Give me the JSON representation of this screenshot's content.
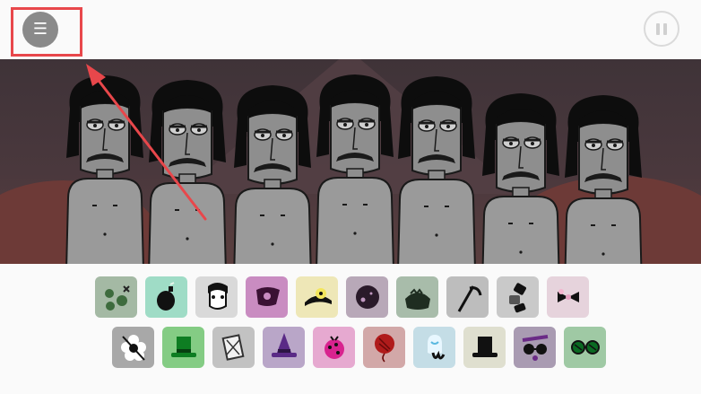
{
  "topbar": {
    "menu_icon": "☰",
    "pause_icon": "pause-icon"
  },
  "colors": {
    "background": "#fafafa",
    "stage_background": "#4a383d",
    "highlight": "#e8474b",
    "menu_button": "#8a8a8a"
  },
  "stage": {
    "characters": [
      "character-1",
      "character-2",
      "character-3",
      "character-4",
      "character-5",
      "character-6",
      "character-7"
    ]
  },
  "palette": {
    "row1": [
      {
        "name": "beat-dots-sound",
        "bg": "#a4b9a4"
      },
      {
        "name": "bomb-sound",
        "bg": "#9fdcc6"
      },
      {
        "name": "face-sound",
        "bg": "#d9d9d9"
      },
      {
        "name": "skull-cap-sound",
        "bg": "#c98cc1"
      },
      {
        "name": "yellow-cap-sound",
        "bg": "#eee7b7"
      },
      {
        "name": "dark-ball-sound",
        "bg": "#b8a8b8"
      },
      {
        "name": "green-cap-sound",
        "bg": "#a8bcaa"
      },
      {
        "name": "scythe-sound",
        "bg": "#bdbdbd"
      },
      {
        "name": "blocks-sound",
        "bg": "#c9c9c9"
      },
      {
        "name": "bow-sound",
        "bg": "#e6d3dc"
      }
    ],
    "row2": [
      {
        "name": "flower-sound",
        "bg": "#a8a8a8"
      },
      {
        "name": "green-tophat-sound",
        "bg": "#84cc84"
      },
      {
        "name": "card-sound",
        "bg": "#c2c2c2"
      },
      {
        "name": "witch-hat-sound",
        "bg": "#b9a6c8"
      },
      {
        "name": "pink-bug-sound",
        "bg": "#e6a9d0"
      },
      {
        "name": "red-balloon-sound",
        "bg": "#d2a8a8"
      },
      {
        "name": "ghost-sound",
        "bg": "#c4dde6"
      },
      {
        "name": "black-tophat-sound",
        "bg": "#dfdfcf"
      },
      {
        "name": "sunglasses-sound",
        "bg": "#a99bb2"
      },
      {
        "name": "green-glasses-sound",
        "bg": "#9fc9a4"
      }
    ]
  }
}
